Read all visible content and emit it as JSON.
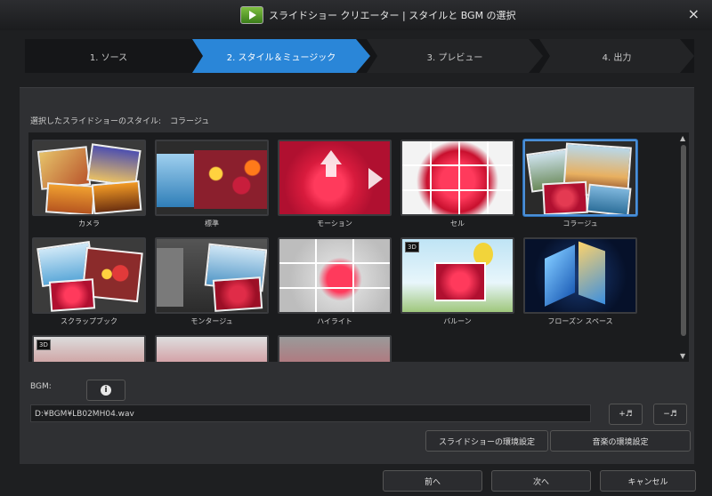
{
  "window": {
    "title": "スライドショー クリエーター | スタイルと BGM の選択",
    "close": "×"
  },
  "steps": [
    {
      "label": "1. ソース"
    },
    {
      "label": "2. スタイル＆ミュージック"
    },
    {
      "label": "3. プレビュー"
    },
    {
      "label": "4. 出力"
    }
  ],
  "style_selector": {
    "label": "選択したスライドショーのスタイル:",
    "value": "コラージュ"
  },
  "styles": [
    {
      "caption": "カメラ",
      "icon": "camera-style-thumbnail"
    },
    {
      "caption": "標準",
      "icon": "standard-style-thumbnail"
    },
    {
      "caption": "モーション",
      "icon": "motion-style-thumbnail"
    },
    {
      "caption": "セル",
      "icon": "cell-style-thumbnail"
    },
    {
      "caption": "コラージュ",
      "icon": "collage-style-thumbnail"
    },
    {
      "caption": "スクラップブック",
      "icon": "scrapbook-style-thumbnail"
    },
    {
      "caption": "モンタージュ",
      "icon": "montage-style-thumbnail"
    },
    {
      "caption": "ハイライト",
      "icon": "highlight-style-thumbnail"
    },
    {
      "caption": "バルーン",
      "icon": "balloon-style-thumbnail",
      "badge": "3D"
    },
    {
      "caption": "フローズン スペース",
      "icon": "frozen-space-style-thumbnail"
    },
    {
      "caption": "",
      "icon": "style-thumbnail-11",
      "badge": "3D"
    },
    {
      "caption": "",
      "icon": "style-thumbnail-12"
    },
    {
      "caption": "",
      "icon": "style-thumbnail-13"
    }
  ],
  "bgm": {
    "label": "BGM:",
    "info_icon": "i",
    "path": "D:¥BGM¥LB02MH04.wav",
    "add_label": "+♬",
    "remove_label": "−♬",
    "slideshow_settings": "スライドショーの環境設定",
    "music_settings": "音楽の環境設定"
  },
  "nav": {
    "back": "前へ",
    "next": "次へ",
    "cancel": "キャンセル"
  },
  "colors": {
    "accent": "#2a86d8",
    "selected_border": "#4c8fd6",
    "background": "#1e1f21"
  }
}
